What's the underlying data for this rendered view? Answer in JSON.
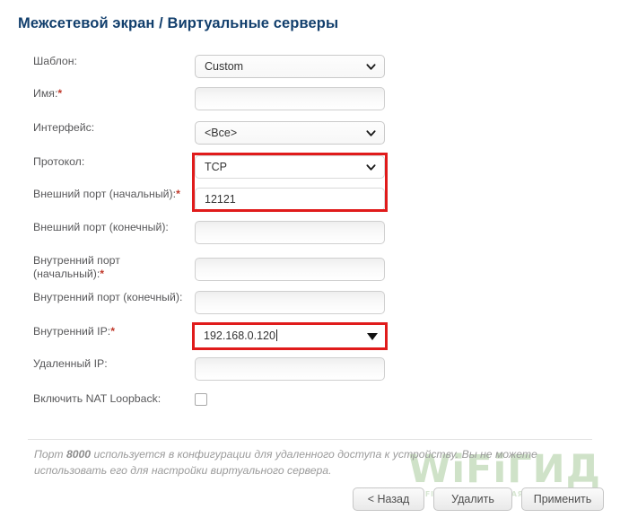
{
  "page": {
    "title": "Межсетевой экран /  Виртуальные серверы"
  },
  "form": {
    "rows": [
      {
        "label": "Шаблон:",
        "required": false,
        "control": "select",
        "value": "Custom",
        "name": "template"
      },
      {
        "label": "Имя:",
        "required": true,
        "control": "text",
        "value": "",
        "name": "name"
      },
      {
        "label": "Интерфейс:",
        "required": false,
        "control": "select",
        "value": "<Все>",
        "name": "interface"
      },
      {
        "label": "Протокол:",
        "required": false,
        "control": "select",
        "value": "TCP",
        "name": "protocol",
        "highlighted": true
      },
      {
        "label": "Внешний порт (начальный):",
        "required": true,
        "control": "text",
        "value": "12121",
        "name": "external-port-start",
        "highlighted": true
      },
      {
        "label": "Внешний порт (конечный):",
        "required": false,
        "control": "text",
        "value": "",
        "name": "external-port-end"
      },
      {
        "label": "Внутренний порт (начальный):",
        "required": true,
        "control": "text",
        "value": "",
        "name": "internal-port-start"
      },
      {
        "label": "Внутренний порт (конечный):",
        "required": false,
        "control": "text",
        "value": "",
        "name": "internal-port-end"
      },
      {
        "label": "Внутренний IP:",
        "required": true,
        "control": "combo",
        "value": "192.168.0.120",
        "name": "internal-ip",
        "highlighted": true
      },
      {
        "label": "Удаленный IP:",
        "required": false,
        "control": "text",
        "value": "",
        "name": "remote-ip"
      },
      {
        "label": "Включить NAT Loopback:",
        "required": false,
        "control": "checkbox",
        "checked": false,
        "name": "nat-loopback"
      }
    ]
  },
  "note": {
    "part1": "Порт ",
    "bold": "8000",
    "part2": " используется в конфигурации для удаленного доступа к устройству. Вы не можете использовать его для настройки виртуального сервера."
  },
  "buttons": {
    "back": "< Назад",
    "delete": "Удалить",
    "apply": "Применить"
  },
  "watermark": {
    "main": "WiFiГИД",
    "sub": "WI-FI И ВСЯ ВСЕМИРНАЯ СЕТЬ"
  },
  "colors": {
    "title": "#123f6d",
    "highlight": "#e01b1b",
    "required_asterisk": "#c0392b",
    "label": "#58585a",
    "note": "#9b9b9b",
    "watermark": "#cfe2c8"
  }
}
